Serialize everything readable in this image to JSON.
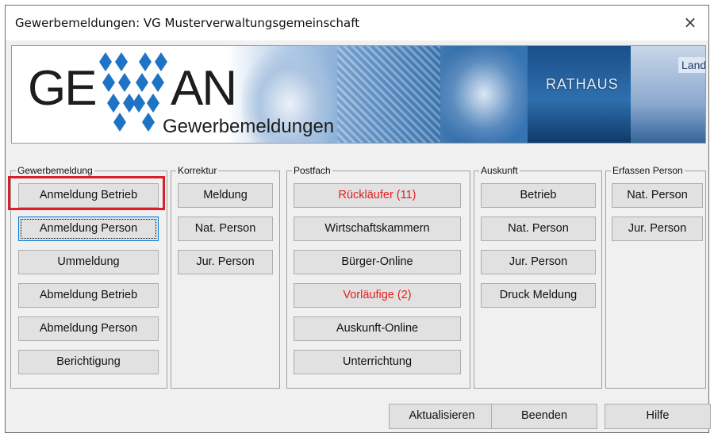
{
  "window": {
    "title": "Gewerbemeldungen: VG Musterverwaltungsgemeinschaft",
    "close_glyph": "×"
  },
  "banner": {
    "logo_left": "GE",
    "logo_right": "AN",
    "subtitle": "Gewerbemeldungen",
    "rathaus_text": "RATHAUS",
    "landrat_text": "Landrat"
  },
  "groups": {
    "gewerbemeldung": {
      "label": "Gewerbemeldung",
      "buttons": [
        "Anmeldung Betrieb",
        "Anmeldung Person",
        "Ummeldung",
        "Abmeldung Betrieb",
        "Abmeldung Person",
        "Berichtigung"
      ]
    },
    "korrektur": {
      "label": "Korrektur",
      "buttons": [
        "Meldung",
        "Nat. Person",
        "Jur. Person"
      ]
    },
    "postfach": {
      "label": "Postfach",
      "buttons": [
        "Rückläufer (11)",
        "Wirtschaftskammern",
        "Bürger-Online",
        "Vorläufige (2)",
        "Auskunft-Online",
        "Unterrichtung"
      ]
    },
    "auskunft": {
      "label": "Auskunft",
      "buttons": [
        "Betrieb",
        "Nat. Person",
        "Jur. Person",
        "Druck Meldung"
      ]
    },
    "erfassen": {
      "label": "Erfassen Person",
      "buttons": [
        "Nat. Person",
        "Jur. Person"
      ]
    }
  },
  "footer": {
    "refresh_label": "Aktualisieren",
    "quit_label": "Beenden",
    "help_label": "Hilfe"
  },
  "colors": {
    "alert_text": "#e02020",
    "highlight": "#d81f2a",
    "focus": "#0078d7"
  }
}
